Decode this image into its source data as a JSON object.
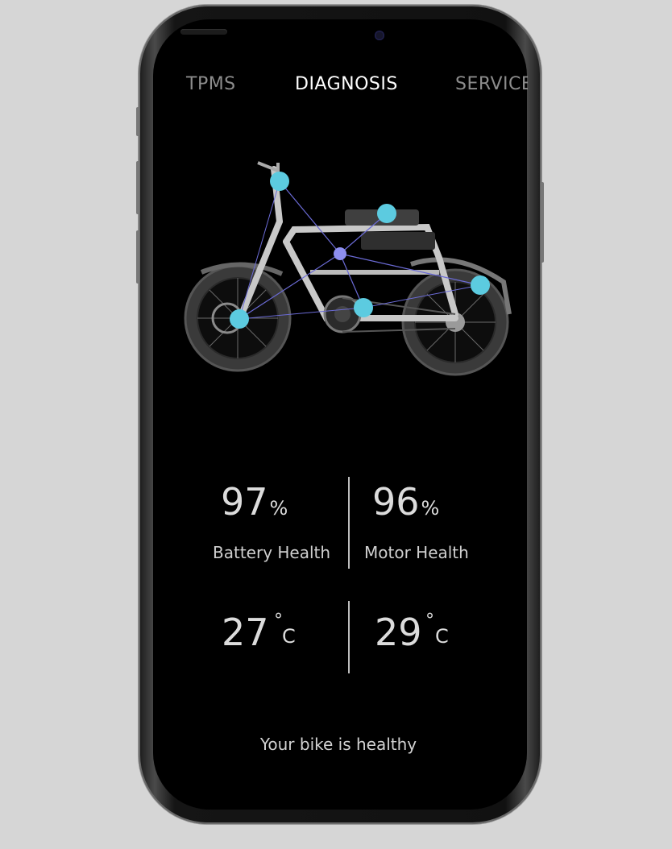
{
  "nav": {
    "tabs": [
      {
        "label": "TPMS",
        "active": false
      },
      {
        "label": "DIAGNOSIS",
        "active": true
      },
      {
        "label": "SERVICE",
        "active": false
      }
    ]
  },
  "stats": {
    "battery": {
      "value": "97",
      "unit": "%",
      "label": "Battery Health"
    },
    "motor": {
      "value": "96",
      "unit": "%",
      "label": "Motor Health"
    }
  },
  "temperatures": {
    "battery": {
      "value": "27",
      "degree_symbol": "°",
      "unit": "C"
    },
    "motor": {
      "value": "29",
      "degree_symbol": "°",
      "unit": "C"
    }
  },
  "status_message": "Your bike is healthy",
  "colors": {
    "background": "#d6d6d6",
    "screen": "#000000",
    "sensor_node": "#5ccbe0",
    "hub_node": "#8d8ef0",
    "link_line": "#6b6bd6",
    "active_tab": "#ffffff",
    "inactive_tab": "#8c8c8c"
  },
  "icons": [
    "phone-frame",
    "e-bike-diagram",
    "sensor-node-icon",
    "hub-node-icon"
  ]
}
